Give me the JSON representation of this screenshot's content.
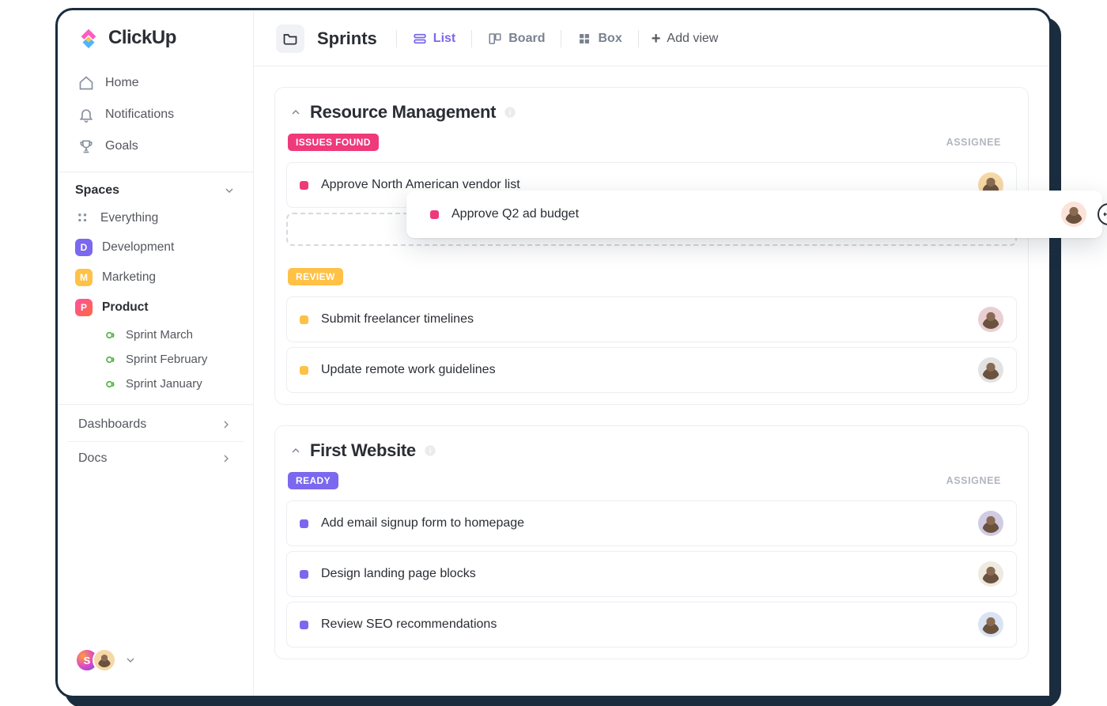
{
  "brand": {
    "name": "ClickUp"
  },
  "sidebar": {
    "nav": {
      "home": "Home",
      "notifications": "Notifications",
      "goals": "Goals"
    },
    "spaces_header": "Spaces",
    "everything": "Everything",
    "spaces": [
      {
        "initial": "D",
        "label": "Development"
      },
      {
        "initial": "M",
        "label": "Marketing"
      },
      {
        "initial": "P",
        "label": "Product"
      }
    ],
    "sprints": [
      {
        "label": "Sprint  March"
      },
      {
        "label": "Sprint  February"
      },
      {
        "label": "Sprint January"
      }
    ],
    "dashboards": "Dashboards",
    "docs": "Docs",
    "footer_initial": "S"
  },
  "header": {
    "title": "Sprints",
    "views": {
      "list": "List",
      "board": "Board",
      "box": "Box",
      "add": "Add view"
    }
  },
  "columns": {
    "assignee": "ASSIGNEE"
  },
  "lists": {
    "rm": {
      "title": "Resource Management",
      "status_issues": "ISSUES FOUND",
      "status_review": "REVIEW",
      "tasks": {
        "t1": "Approve North American vendor list",
        "t2_drag": "Approve Q2 ad budget",
        "t3": "Submit freelancer timelines",
        "t4": "Update remote work guidelines"
      }
    },
    "fw": {
      "title": "First Website",
      "status_ready": "READY",
      "tasks": {
        "t1": "Add email signup form to homepage",
        "t2": "Design landing page blocks",
        "t3": "Review SEO recommendations"
      }
    }
  }
}
